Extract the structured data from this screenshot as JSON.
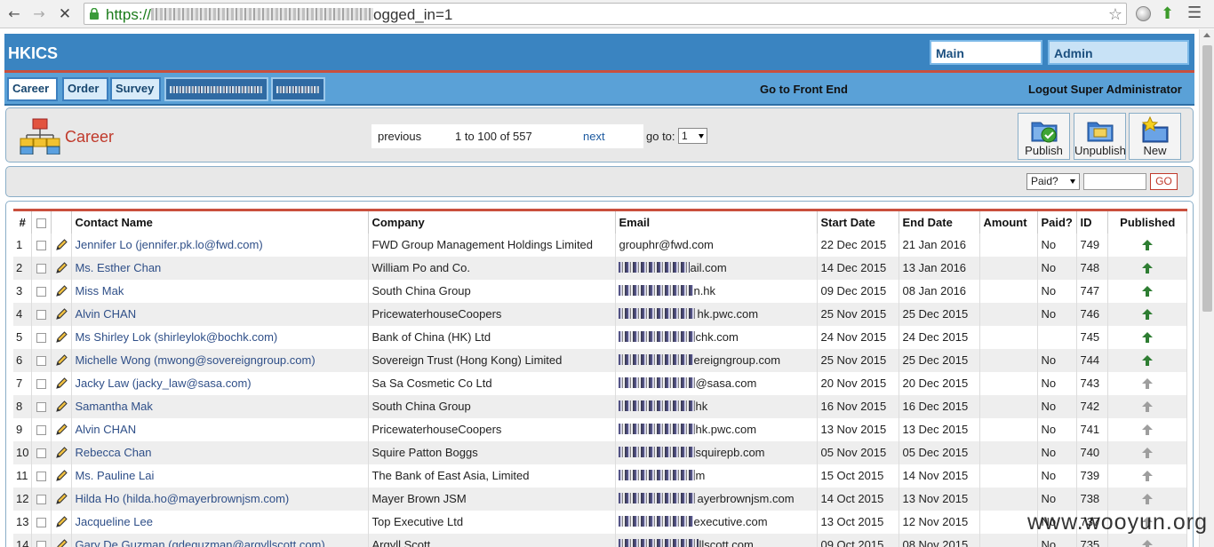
{
  "browser": {
    "url_scheme": "https://",
    "url_tail": "ogged_in=1"
  },
  "header": {
    "brand": "HKICS",
    "tabs": [
      "Main",
      "Admin"
    ]
  },
  "subnav": {
    "tabs": [
      "Career",
      "Order",
      "Survey"
    ],
    "front_end_link": "Go to Front End",
    "logout_link": "Logout Super Administrator"
  },
  "career": {
    "title": "Career",
    "pager": {
      "previous": "previous",
      "range": "1 to 100 of 557",
      "next": "next",
      "goto_label": "go to:",
      "goto_value": "1"
    },
    "toolbar": {
      "publish": "Publish",
      "unpublish": "Unpublish",
      "new": "New"
    }
  },
  "filter": {
    "paid_placeholder": "Paid?",
    "go": "GO"
  },
  "table": {
    "columns": [
      "#",
      "",
      "Contact Name",
      "Company",
      "Email",
      "Start Date",
      "End Date",
      "Amount",
      "Paid?",
      "ID",
      "Published"
    ],
    "rows": [
      {
        "n": "1",
        "name": "Jennifer Lo (jennifer.pk.lo@fwd.com)",
        "company": "FWD Group Management Holdings Limited",
        "email": "grouphr@fwd.com",
        "start": "22 Dec 2015",
        "end": "21 Jan 2016",
        "amount": "",
        "paid": "No",
        "id": "749",
        "published": true
      },
      {
        "n": "2",
        "name": "Ms. Esther Chan",
        "company": "William Po and Co.",
        "email": "ail.com",
        "start": "14 Dec 2015",
        "end": "13 Jan 2016",
        "amount": "",
        "paid": "No",
        "id": "748",
        "published": true
      },
      {
        "n": "3",
        "name": "Miss Mak",
        "company": "South China Group",
        "email": "n.hk",
        "start": "09 Dec 2015",
        "end": "08 Jan 2016",
        "amount": "",
        "paid": "No",
        "id": "747",
        "published": true
      },
      {
        "n": "4",
        "name": "Alvin CHAN",
        "company": "PricewaterhouseCoopers",
        "email": "hk.pwc.com",
        "start": "25 Nov 2015",
        "end": "25 Dec 2015",
        "amount": "",
        "paid": "No",
        "id": "746",
        "published": true
      },
      {
        "n": "5",
        "name": "Ms Shirley Lok (shirleylok@bochk.com)",
        "company": "Bank of China (HK) Ltd",
        "email": "chk.com",
        "start": "24 Nov 2015",
        "end": "24 Dec 2015",
        "amount": "",
        "paid": "",
        "id": "745",
        "published": true
      },
      {
        "n": "6",
        "name": "Michelle Wong (mwong@sovereigngroup.com)",
        "company": "Sovereign Trust (Hong Kong) Limited",
        "email": "ereigngroup.com",
        "start": "25 Nov 2015",
        "end": "25 Dec 2015",
        "amount": "",
        "paid": "No",
        "id": "744",
        "published": true
      },
      {
        "n": "7",
        "name": "Jacky Law (jacky_law@sasa.com)",
        "company": "Sa Sa Cosmetic Co Ltd",
        "email": "@sasa.com",
        "start": "20 Nov 2015",
        "end": "20 Dec 2015",
        "amount": "",
        "paid": "No",
        "id": "743",
        "published": false
      },
      {
        "n": "8",
        "name": "Samantha Mak",
        "company": "South China Group",
        "email": "hk",
        "start": "16 Nov 2015",
        "end": "16 Dec 2015",
        "amount": "",
        "paid": "No",
        "id": "742",
        "published": false
      },
      {
        "n": "9",
        "name": "Alvin CHAN",
        "company": "PricewaterhouseCoopers",
        "email": "hk.pwc.com",
        "start": "13 Nov 2015",
        "end": "13 Dec 2015",
        "amount": "",
        "paid": "No",
        "id": "741",
        "published": false
      },
      {
        "n": "10",
        "name": "Rebecca Chan",
        "company": "Squire Patton Boggs",
        "email": "squirepb.com",
        "start": "05 Nov 2015",
        "end": "05 Dec 2015",
        "amount": "",
        "paid": "No",
        "id": "740",
        "published": false
      },
      {
        "n": "11",
        "name": "Ms. Pauline Lai",
        "company": "The Bank of East Asia, Limited",
        "email": "m",
        "start": "15 Oct 2015",
        "end": "14 Nov 2015",
        "amount": "",
        "paid": "No",
        "id": "739",
        "published": false
      },
      {
        "n": "12",
        "name": "Hilda Ho (hilda.ho@mayerbrownjsm.com)",
        "company": "Mayer Brown JSM",
        "email": "ayerbrownjsm.com",
        "start": "14 Oct 2015",
        "end": "13 Nov 2015",
        "amount": "",
        "paid": "No",
        "id": "738",
        "published": false
      },
      {
        "n": "13",
        "name": "Jacqueline Lee",
        "company": "Top Executive Ltd",
        "email": "executive.com",
        "start": "13 Oct 2015",
        "end": "12 Nov 2015",
        "amount": "",
        "paid": "No",
        "id": "737",
        "published": false
      },
      {
        "n": "14",
        "name": "Gary De Guzman (gdeguzman@argyllscott.com)",
        "company": "Argyll Scott",
        "email": "llscott.com",
        "start": "09 Oct 2015",
        "end": "08 Nov 2015",
        "amount": "",
        "paid": "No",
        "id": "735",
        "published": false
      }
    ]
  },
  "colors": {
    "header_blue": "#3a84c1",
    "accent_red": "#c94f3d",
    "published_green": "#2e7d32",
    "unpublished_gray": "#9e9e9e"
  },
  "watermark": "www.wooyun.org"
}
